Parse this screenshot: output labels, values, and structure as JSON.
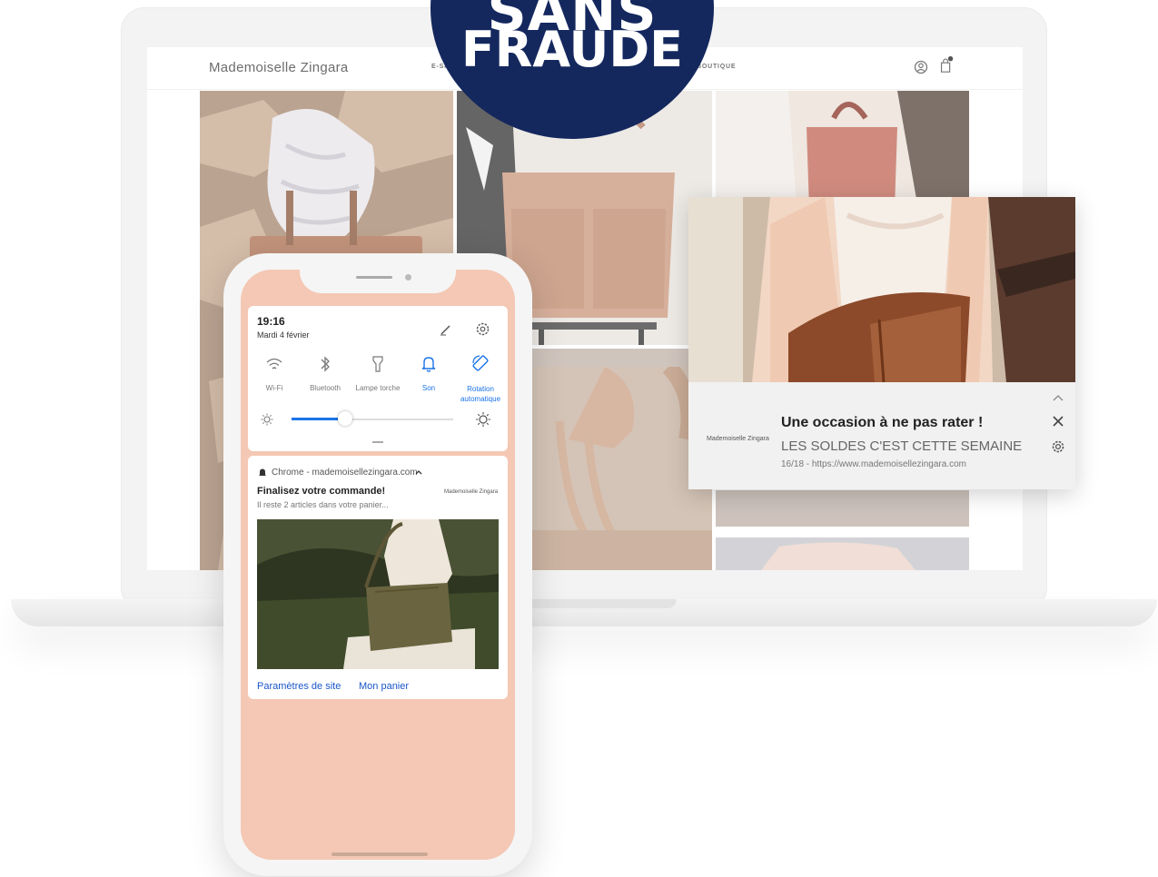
{
  "badge": {
    "line1": "SANS",
    "line2": "FRAUDE"
  },
  "laptop": {
    "site_logo": "Mademoiselle Zingara",
    "nav": [
      "E-SHOP",
      "BOUTIQUE"
    ],
    "icons": [
      "user-icon",
      "cart-icon"
    ]
  },
  "desktop_notification": {
    "site": "Mademoiselle Zingara",
    "title": "Une occasion à ne pas rater !",
    "subtitle": "LES SOLDES C'EST CETTE SEMAINE",
    "url": "16/18 - https://www.mademoisellezingara.com"
  },
  "phone": {
    "time": "19:16",
    "date": "Mardi 4 février",
    "toggles": [
      {
        "label": "Wi-Fi",
        "icon": "wifi-icon",
        "active": false
      },
      {
        "label": "Bluetooth",
        "icon": "bluetooth-icon",
        "active": false
      },
      {
        "label": "Lampe torche",
        "icon": "flashlight-icon",
        "active": false
      },
      {
        "label": "Son",
        "icon": "bell-icon",
        "active": true
      },
      {
        "label": "Rotation automatique",
        "icon": "rotation-icon",
        "active": true
      }
    ],
    "brightness": 0.33,
    "notification": {
      "app": "Chrome - mademoisellezingara.com",
      "title": "Finalisez votre commande!",
      "text": "Il reste 2 articles dans votre panier...",
      "brand": "Mademoiselle Zingara",
      "actions": [
        "Paramètres de site",
        "Mon panier"
      ]
    }
  },
  "colors": {
    "badge": "#14285e",
    "phone_bg": "#f4c8b4",
    "link": "#1a56c8",
    "toggle_on": "#1a73e8"
  }
}
